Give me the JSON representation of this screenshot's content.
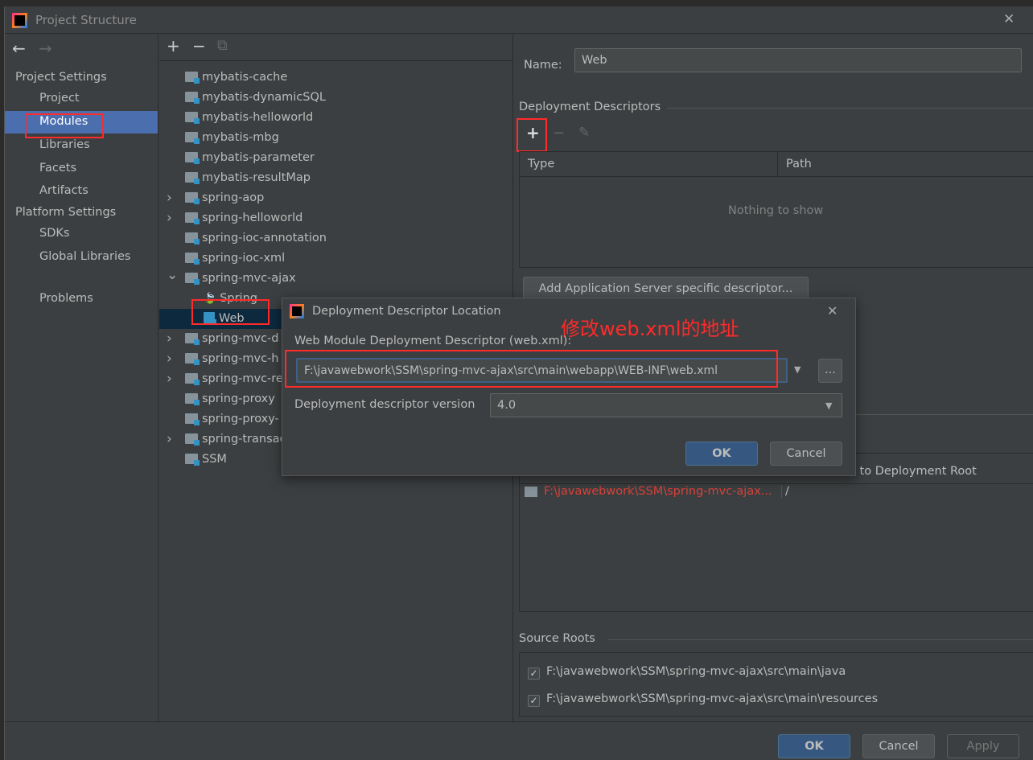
{
  "window": {
    "title": "Project Structure",
    "close": "✕"
  },
  "nav": {
    "back": "←",
    "forward": "→"
  },
  "sidebar": {
    "project_settings": "Project Settings",
    "items": [
      "Project",
      "Modules",
      "Libraries",
      "Facets",
      "Artifacts"
    ],
    "platform_settings": "Platform Settings",
    "platform_items": [
      "SDKs",
      "Global Libraries"
    ],
    "problems": "Problems"
  },
  "toolbar": {
    "add": "+",
    "remove": "−",
    "copy": "⧉"
  },
  "tree": {
    "items": [
      "mybatis-cache",
      "mybatis-dynamicSQL",
      "mybatis-helloworld",
      "mybatis-mbg",
      "mybatis-parameter",
      "mybatis-resultMap",
      "spring-aop",
      "spring-helloworld",
      "spring-ioc-annotation",
      "spring-ioc-xml",
      "spring-mvc-ajax",
      "Spring",
      "Web",
      "spring-mvc-d",
      "spring-mvc-h",
      "spring-mvc-re",
      "spring-proxy",
      "spring-proxy-",
      "spring-transac",
      "SSM"
    ]
  },
  "right": {
    "name_label": "Name:",
    "name_value": "Web",
    "deployment_descriptors": "Deployment Descriptors",
    "col_type": "Type",
    "col_path": "Path",
    "empty": "Nothing to show",
    "add_server_descriptor": "Add Application Server specific descriptor...",
    "col_relative": "e to Deployment Root",
    "resource_path": "F:\\javawebwork\\SSM\\spring-mvc-ajax...",
    "resource_root": "/",
    "source_roots": "Source Roots",
    "sources": [
      "F:\\javawebwork\\SSM\\spring-mvc-ajax\\src\\main\\java",
      "F:\\javawebwork\\SSM\\spring-mvc-ajax\\src\\main\\resources"
    ]
  },
  "dialog": {
    "title": "Deployment Descriptor Location",
    "annotation": "修改web.xml的地址",
    "descriptor_label": "Web Module Deployment Descriptor (web.xml):",
    "descriptor_value": "F:\\javawebwork\\SSM\\spring-mvc-ajax\\src\\main\\webapp\\WEB-INF\\web.xml",
    "browse": "...",
    "version_label": "Deployment descriptor version",
    "version_value": "4.0",
    "ok": "OK",
    "cancel": "Cancel",
    "close": "✕"
  },
  "footer": {
    "ok": "OK",
    "cancel": "Cancel",
    "apply": "Apply"
  },
  "colors": {
    "selection": "#4b6eaf",
    "highlight": "#ff2a2a",
    "error_text": "#d9423a"
  }
}
